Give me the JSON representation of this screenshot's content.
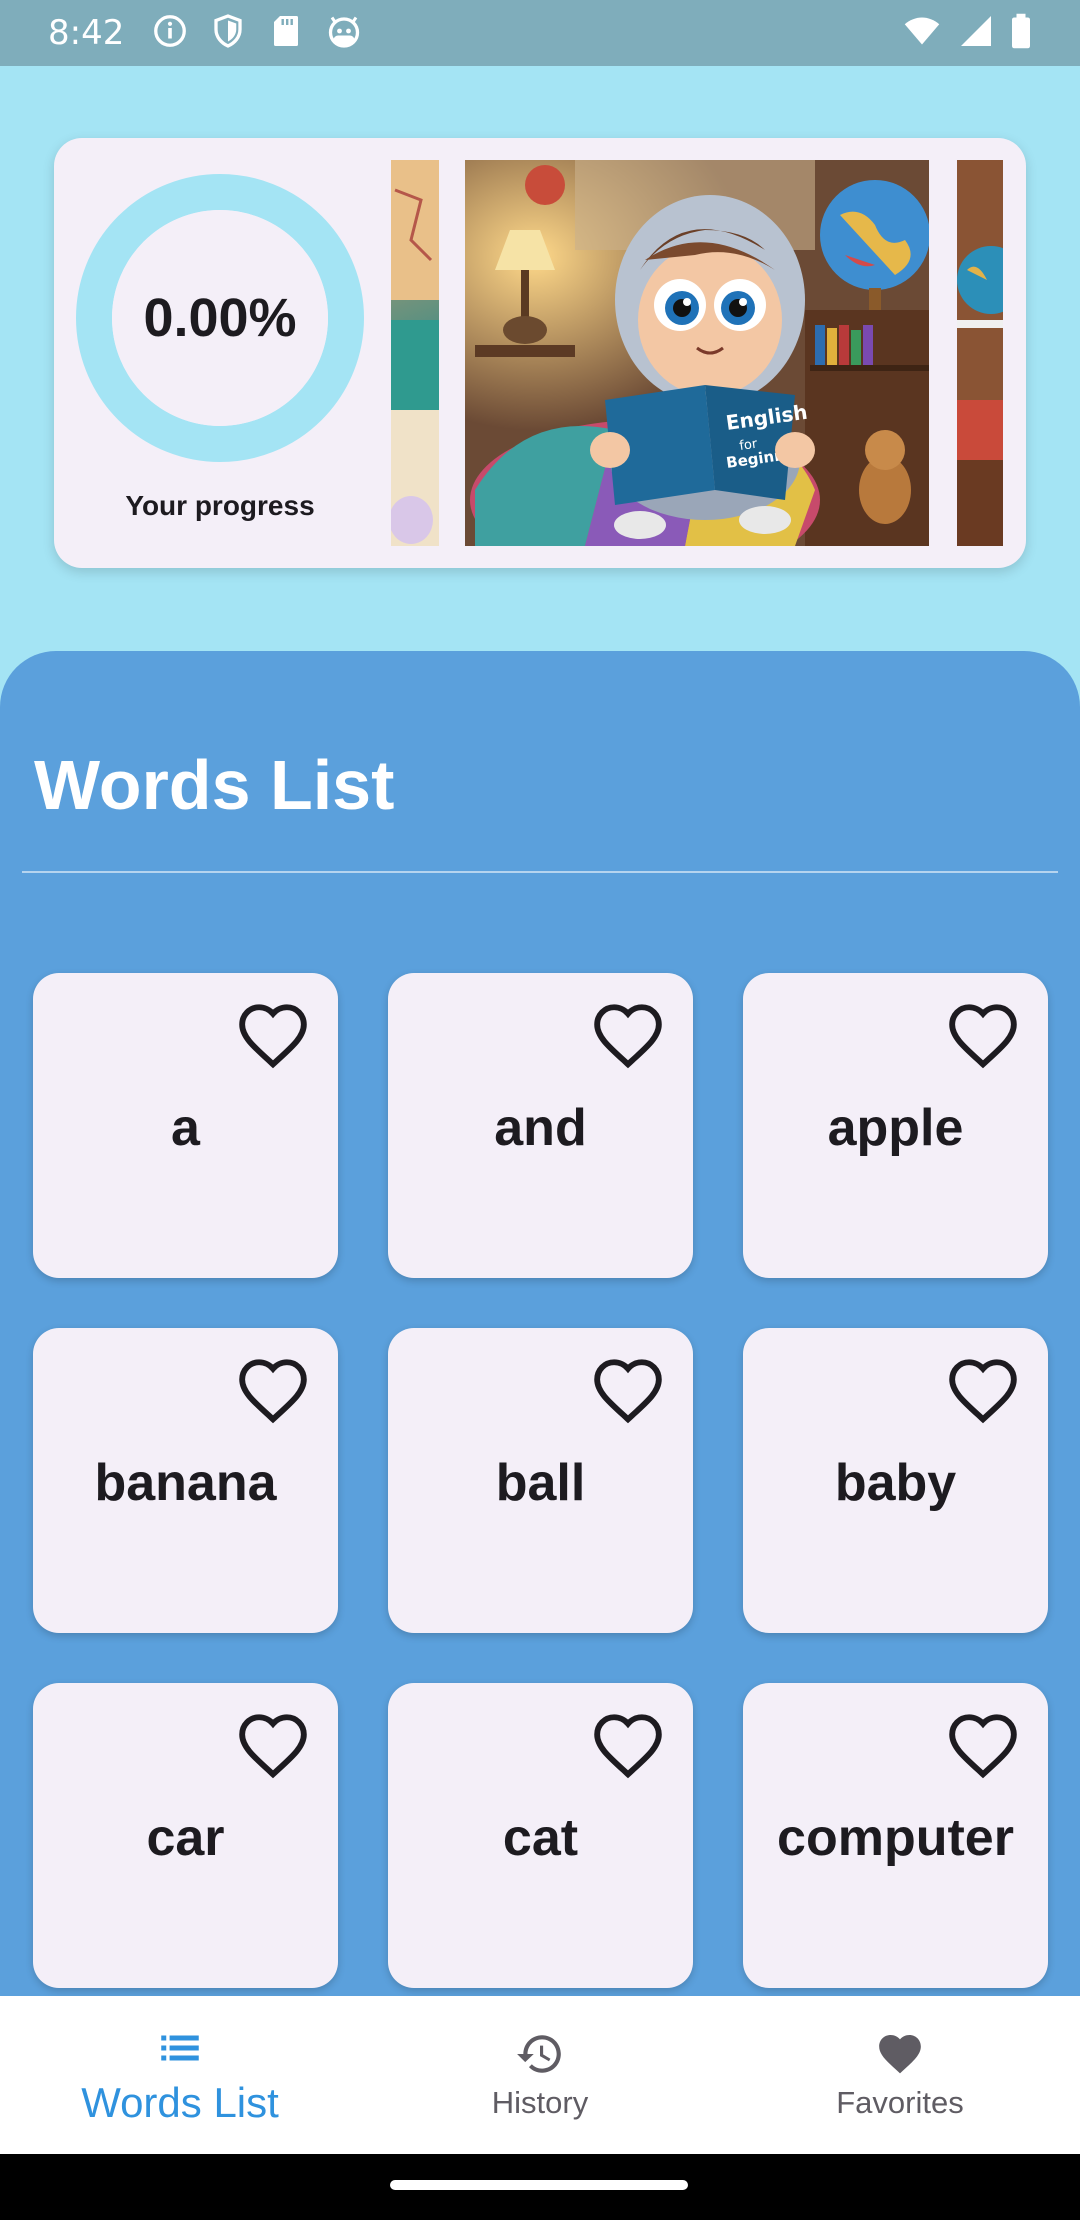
{
  "status_bar": {
    "time": "8:42",
    "left_icons": [
      "info-icon",
      "shield-icon",
      "sd-card-icon",
      "android-head-icon"
    ],
    "right_icons": [
      "wifi-icon",
      "signal-icon",
      "battery-icon"
    ]
  },
  "progress": {
    "value_text": "0.00%",
    "value_fraction": 0.0,
    "label": "Your progress",
    "ring_color": "#a4e4f4"
  },
  "carousel": {
    "book_text": "English for Beginners"
  },
  "words_list": {
    "title": "Words List",
    "words": [
      "a",
      "and",
      "apple",
      "banana",
      "ball",
      "baby",
      "car",
      "cat",
      "computer"
    ]
  },
  "bottom_nav": {
    "items": [
      {
        "label": "Words List",
        "icon": "list-icon",
        "active": true
      },
      {
        "label": "History",
        "icon": "history-icon",
        "active": false
      },
      {
        "label": "Favorites",
        "icon": "heart-filled-icon",
        "active": false
      }
    ]
  },
  "colors": {
    "background": "#a4e4f4",
    "panel": "#5ba0dc",
    "card": "#f4eff8",
    "accent": "#2f92de",
    "status_bar": "#7fadbb"
  }
}
